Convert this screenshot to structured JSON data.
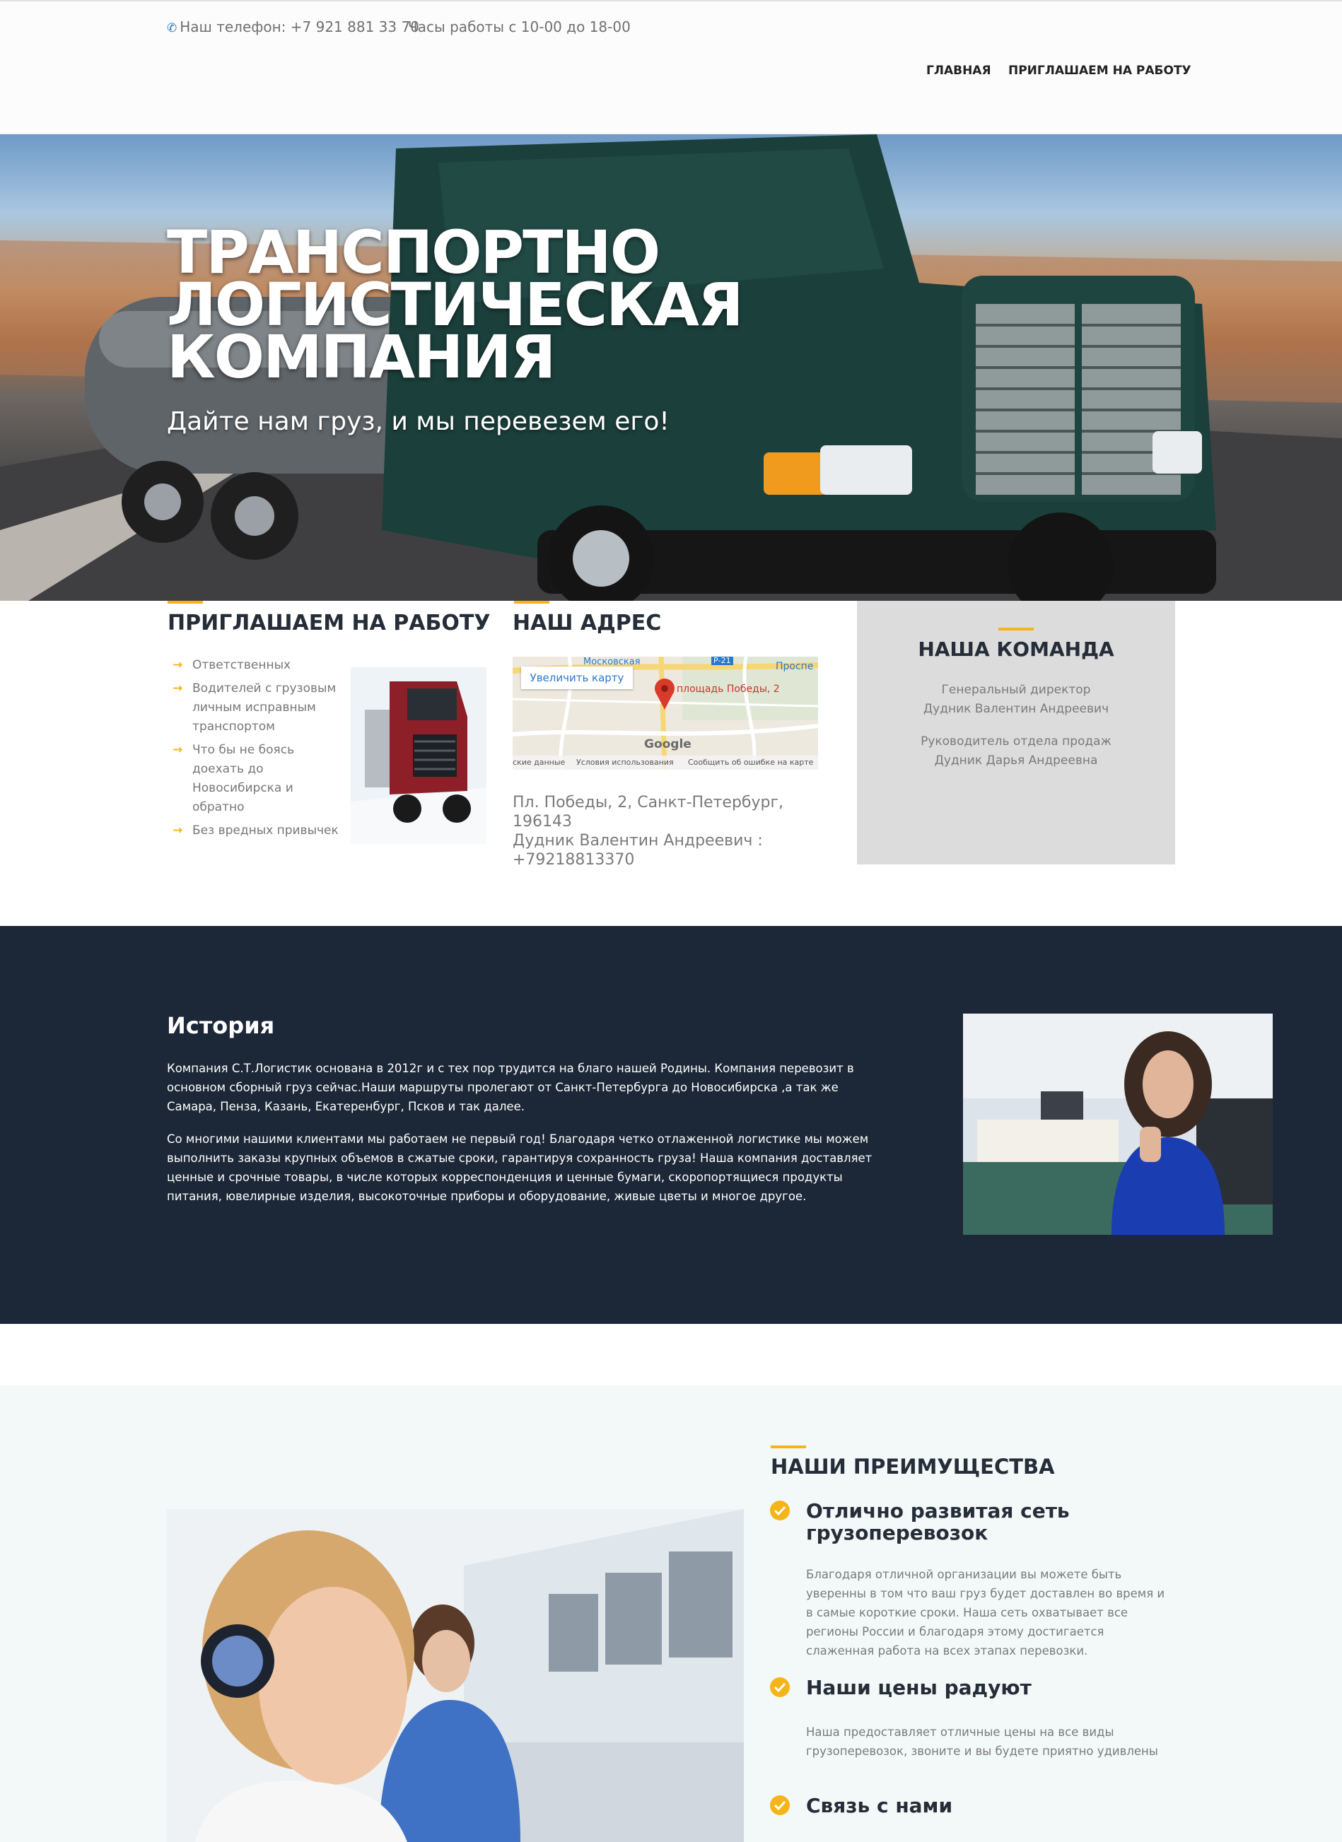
{
  "header": {
    "phone_icon": "phone-icon",
    "phone_text": "Наш телефон: +7 921 881 33 70",
    "hours_text": "Часы работы с 10-00 до 18-00",
    "nav": [
      {
        "label": "ГЛАВНАЯ"
      },
      {
        "label": "ПРИГЛАШАЕМ НА РАБОТУ"
      }
    ]
  },
  "hero": {
    "title_lines": [
      "ТРАНСПОРТНО",
      "ЛОГИСТИЧЕСКАЯ",
      "КОМПАНИЯ"
    ],
    "subtitle": "Дайте нам груз, и мы перевезем его!"
  },
  "jobs": {
    "title": "ПРИГЛАШАЕМ НА РАБОТУ",
    "items": [
      "Ответственных",
      "Водителей с грузовым личным исправным транспортом",
      "Что бы не боясь доехать до Новосибирска и обратно",
      "Без вредных привычек"
    ]
  },
  "address": {
    "title": "НАШ АДРЕС",
    "map": {
      "enlarge_button": "Увеличить карту",
      "marker_label": "площадь Победы, 2",
      "street_label": "Московская",
      "road_label": "Р-21",
      "district_label": "Проспе",
      "brand": "Google",
      "footer_items": [
        "ские данные",
        "Условия использования",
        "Сообщить об ошибке на карте"
      ]
    },
    "lines": [
      "Пл. Победы, 2, Санкт-Петербург, 196143",
      "Дудник Валентин Андреевич :",
      "+79218813370"
    ]
  },
  "team": {
    "title": "НАША КОМАНДА",
    "members": [
      {
        "role": "Генеральный директор",
        "name": "Дудник Валентин Андреевич"
      },
      {
        "role": "Руководитель отдела продаж",
        "name": "Дудник Дарья Андреевна"
      }
    ]
  },
  "history": {
    "title": "История",
    "paragraphs": [
      "Компания С.Т.Логистик основана в 2012г и с тех пор трудится на благо нашей Родины. Компания перевозит в основном сборный груз сейчас.Наши маршруты пролегают от Санкт-Петербурга до Новосибирска ,а так же Самара, Пенза, Казань, Екатеренбург, Псков и так далее.",
      "Со многими нашими клиентами мы работаем не первый год! Благодаря четко отлаженной логистике мы можем выполнить заказы крупных объемов в сжатые сроки, гарантируя сохранность груза! Наша компания доставляет ценные и срочные товары, в числе которых корреспонденция и ценные бумаги, скоропортящиеся продукты питания, ювелирные изделия, высокоточные приборы и оборудование, живые цветы и многое другое."
    ]
  },
  "advantages": {
    "title": "НАШИ ПРЕИМУЩЕСТВА",
    "items": [
      {
        "title": "Отлично развитая сеть грузоперевозок",
        "text": "Благодаря отличной организации вы можете быть уверенны в том что ваш груз будет доставлен во время и в самые короткие сроки. Наша сеть охватывает все регионы России и благодаря этому достигается слаженная работа на всех этапах перевозки."
      },
      {
        "title": "Наши цены радуют",
        "text": "Наша предоставляет отличные цены на все виды грузоперевозок, звоните и вы будете приятно удивлены"
      },
      {
        "title": "Связь с нами",
        "text": ""
      }
    ]
  },
  "colors": {
    "accent": "#f5b417",
    "dark_section": "#1c2737",
    "heading": "#252d38",
    "team_box": "#dcdcdc",
    "advantages_bg": "#f3f9f9"
  }
}
